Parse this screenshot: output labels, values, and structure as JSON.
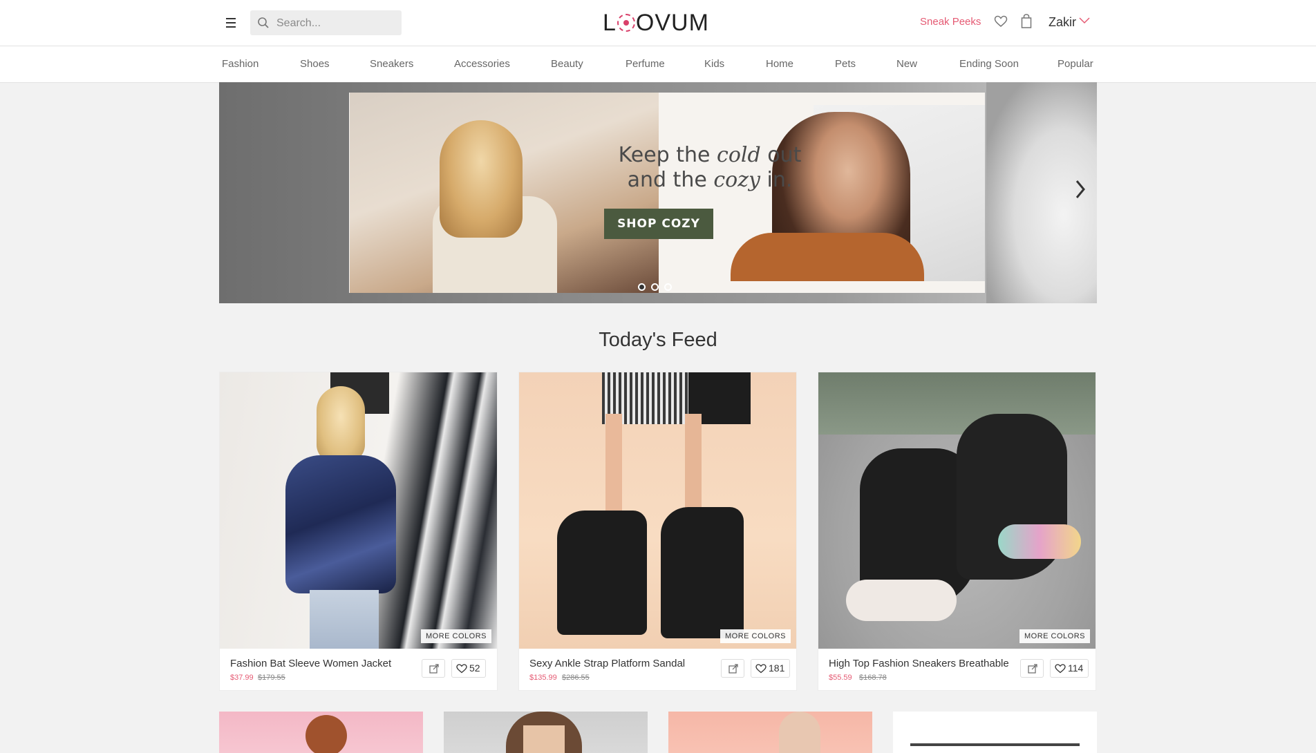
{
  "header": {
    "search_placeholder": "Search...",
    "logo": {
      "part1": "L",
      "part2": "OVUM"
    },
    "sneak_peeks": "Sneak Peeks",
    "user_name": "Zakir"
  },
  "nav": {
    "items": [
      "Fashion",
      "Shoes",
      "Sneakers",
      "Accessories",
      "Beauty",
      "Perfume",
      "Kids",
      "Home",
      "Pets",
      "New",
      "Ending Soon",
      "Popular"
    ]
  },
  "banner": {
    "line1_a": "Keep the",
    "line1_b": "cold",
    "line1_c": "out",
    "line2_a": "and the",
    "line2_b": "cozy",
    "line2_c": "in.",
    "cta": "SHOP COZY",
    "slides": 3,
    "active_slide": 1
  },
  "feed": {
    "title": "Today's Feed",
    "more_colors": "MORE COLORS",
    "products": [
      {
        "name": "Fashion Bat Sleeve Women Jacket",
        "price": "$37.99",
        "original_price": "$179.55",
        "likes": "52"
      },
      {
        "name": "Sexy Ankle Strap Platform Sandal",
        "price": "$135.99",
        "original_price": "$286.55",
        "likes": "181"
      },
      {
        "name": "High Top Fashion Sneakers Breathable",
        "price": "$55.59",
        "original_price": "$168.78",
        "likes": "114"
      }
    ]
  },
  "colors": {
    "accent": "#e55a73",
    "cta_bg": "#4b5a3f",
    "background": "#f2f2f2"
  }
}
